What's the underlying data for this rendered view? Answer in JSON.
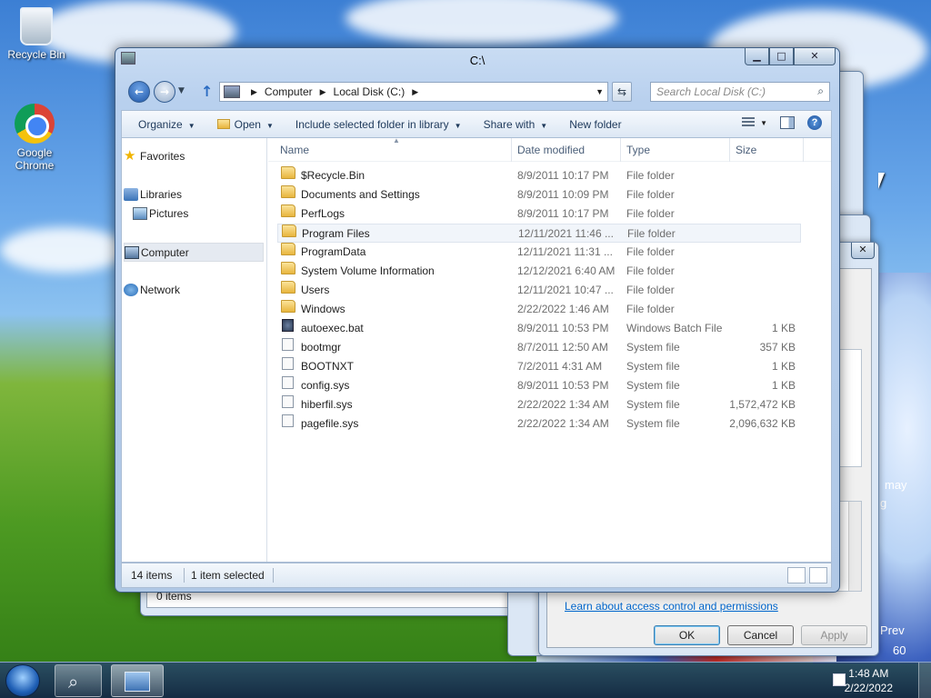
{
  "desktop": {
    "icons": [
      {
        "label": "Recycle Bin",
        "icon": "recycle-bin-icon"
      },
      {
        "label": "Google Chrome",
        "icon": "chrome-icon"
      }
    ],
    "wallpaper_text": [
      "may",
      "g",
      "Prev",
      "60"
    ]
  },
  "properties_dialog": {
    "link": "Learn about access control and permissions",
    "ok": "OK",
    "cancel": "Cancel",
    "apply": "Apply"
  },
  "background_window": {
    "status": "0 items"
  },
  "explorer": {
    "title": "C:\\",
    "caption": {
      "minimize": "▁",
      "maximize": "□",
      "close": "✕"
    },
    "breadcrumb": [
      "Computer",
      "Local Disk (C:)"
    ],
    "search_placeholder": "Search Local Disk (C:)",
    "toolbar": {
      "organize": "Organize",
      "open": "Open",
      "include": "Include selected folder in library",
      "share": "Share with",
      "new_folder": "New folder"
    },
    "nav": {
      "favorites": "Favorites",
      "libraries": "Libraries",
      "pictures": "Pictures",
      "computer": "Computer",
      "network": "Network"
    },
    "columns": {
      "name": "Name",
      "date": "Date modified",
      "type": "Type",
      "size": "Size"
    },
    "files": [
      {
        "name": "$Recycle.Bin",
        "date": "8/9/2011 10:17 PM",
        "type": "File folder",
        "size": "",
        "icon": "folder"
      },
      {
        "name": "Documents and Settings",
        "date": "8/9/2011 10:09 PM",
        "type": "File folder",
        "size": "",
        "icon": "shortcut-folder"
      },
      {
        "name": "PerfLogs",
        "date": "8/9/2011 10:17 PM",
        "type": "File folder",
        "size": "",
        "icon": "folder"
      },
      {
        "name": "Program Files",
        "date": "12/11/2021 11:46 ...",
        "type": "File folder",
        "size": "",
        "icon": "folder",
        "selected": true
      },
      {
        "name": "ProgramData",
        "date": "12/11/2021 11:31 ...",
        "type": "File folder",
        "size": "",
        "icon": "folder"
      },
      {
        "name": "System Volume Information",
        "date": "12/12/2021 6:40 AM",
        "type": "File folder",
        "size": "",
        "icon": "folder"
      },
      {
        "name": "Users",
        "date": "12/11/2021 10:47 ...",
        "type": "File folder",
        "size": "",
        "icon": "folder"
      },
      {
        "name": "Windows",
        "date": "2/22/2022 1:46 AM",
        "type": "File folder",
        "size": "",
        "icon": "folder"
      },
      {
        "name": "autoexec.bat",
        "date": "8/9/2011 10:53 PM",
        "type": "Windows Batch File",
        "size": "1 KB",
        "icon": "gear-file"
      },
      {
        "name": "bootmgr",
        "date": "8/7/2011 12:50 AM",
        "type": "System file",
        "size": "357 KB",
        "icon": "file"
      },
      {
        "name": "BOOTNXT",
        "date": "7/2/2011 4:31 AM",
        "type": "System file",
        "size": "1 KB",
        "icon": "file"
      },
      {
        "name": "config.sys",
        "date": "8/9/2011 10:53 PM",
        "type": "System file",
        "size": "1 KB",
        "icon": "file"
      },
      {
        "name": "hiberfil.sys",
        "date": "2/22/2022 1:34 AM",
        "type": "System file",
        "size": "1,572,472 KB",
        "icon": "file"
      },
      {
        "name": "pagefile.sys",
        "date": "2/22/2022 1:34 AM",
        "type": "System file",
        "size": "2,096,632 KB",
        "icon": "file"
      }
    ],
    "status": {
      "count": "14 items",
      "selection": "1 item selected"
    }
  },
  "taskbar": {
    "time": "1:48 AM",
    "date": "2/22/2022"
  }
}
